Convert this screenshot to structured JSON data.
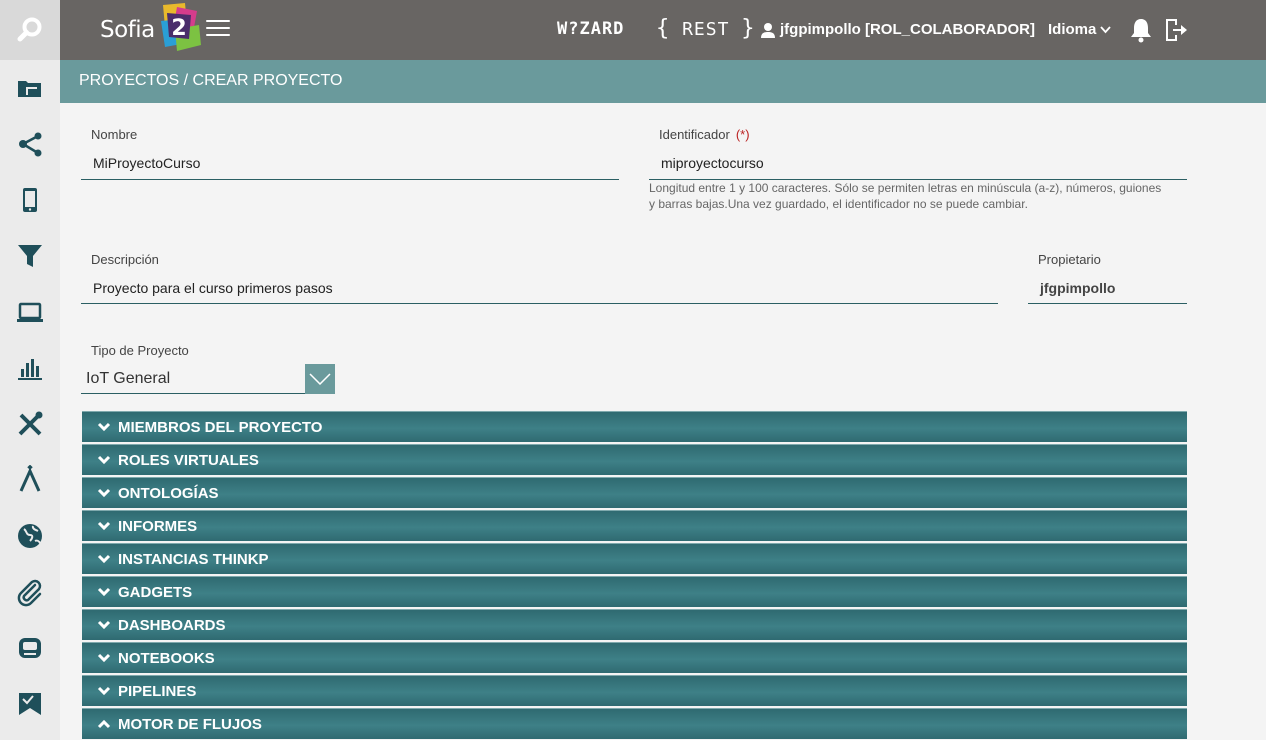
{
  "app": {
    "logo_text": "Sofia",
    "logo_number": "2"
  },
  "topbar": {
    "wizard_label": "W?ZARD",
    "rest_left": "{",
    "rest_label": "REST",
    "rest_right": "}",
    "user_label": "jfgpimpollo [ROL_COLABORADOR]",
    "language_label": "Idioma"
  },
  "sidebar": {
    "items": [
      {
        "icon": "folder-icon"
      },
      {
        "icon": "share-icon"
      },
      {
        "icon": "mobile-icon"
      },
      {
        "icon": "filter-icon"
      },
      {
        "icon": "laptop-icon"
      },
      {
        "icon": "bar-chart-icon"
      },
      {
        "icon": "tools-icon"
      },
      {
        "icon": "branch-icon"
      },
      {
        "icon": "globe-icon"
      },
      {
        "icon": "paperclip-icon"
      },
      {
        "icon": "device-icon"
      },
      {
        "icon": "map-icon"
      }
    ]
  },
  "breadcrumb": "PROYECTOS / CREAR PROYECTO",
  "form": {
    "nombre_label": "Nombre",
    "nombre_value": "MiProyectoCurso",
    "identificador_label": "Identificador",
    "required_mark": "(*)",
    "identificador_value": "miproyectocurso",
    "identificador_hint": "Longitud entre 1 y 100 caracteres. Sólo se permiten letras en minúscula (a-z), números, guiones y barras bajas.Una vez guardado, el identificador no se puede cambiar.",
    "descripcion_label": "Descripción",
    "descripcion_value": "Proyecto para el curso primeros pasos",
    "propietario_label": "Propietario",
    "propietario_value": "jfgpimpollo",
    "tipo_label": "Tipo de Proyecto",
    "tipo_value": "IoT General"
  },
  "sections": [
    {
      "label": "MIEMBROS DEL PROYECTO",
      "expanded": false
    },
    {
      "label": "ROLES VIRTUALES",
      "expanded": false
    },
    {
      "label": "ONTOLOGÍAS",
      "expanded": false
    },
    {
      "label": "INFORMES",
      "expanded": false
    },
    {
      "label": "INSTANCIAS THINKP",
      "expanded": false
    },
    {
      "label": "GADGETS",
      "expanded": false
    },
    {
      "label": "DASHBOARDS",
      "expanded": false
    },
    {
      "label": "NOTEBOOKS",
      "expanded": false
    },
    {
      "label": "PIPELINES",
      "expanded": false
    },
    {
      "label": "MOTOR DE FLUJOS",
      "expanded": true
    }
  ],
  "colors": {
    "topbar": "#686563",
    "breadcrumb_bar": "#6a9a9c",
    "accordion": "#3a7a80",
    "sidebar_icon": "#1f4f5a"
  }
}
